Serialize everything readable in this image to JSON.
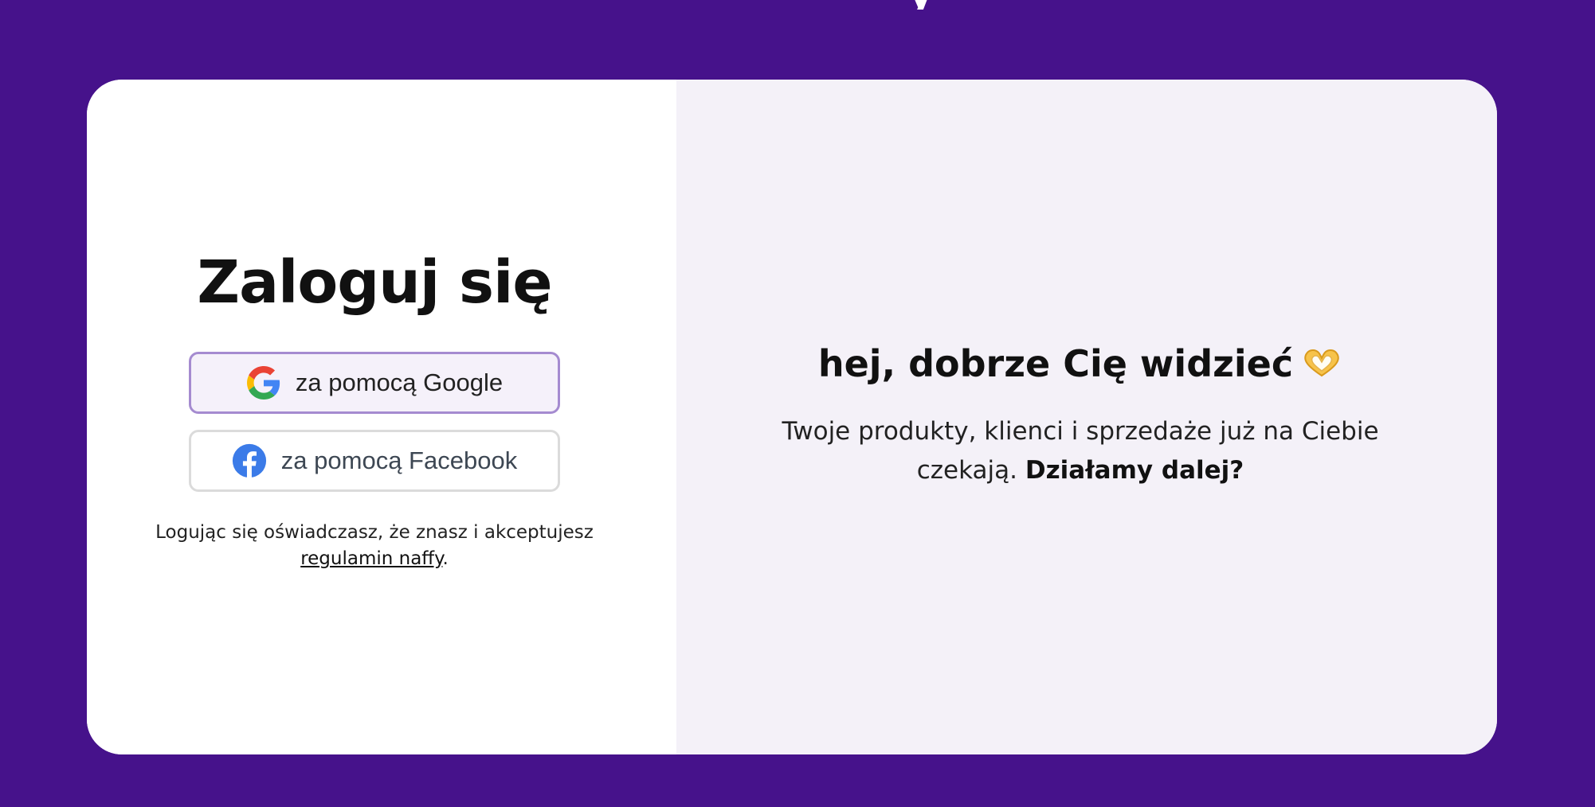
{
  "brand": {
    "logo_fragment": "y",
    "background_color": "#46128b",
    "accent_color": "#a58bd0"
  },
  "login": {
    "title": "Zaloguj się",
    "google_button": {
      "label": "za pomocą Google",
      "icon": "google-icon"
    },
    "facebook_button": {
      "label": "za pomocą Facebook",
      "icon": "facebook-icon"
    },
    "terms_prefix": "Logując się oświadczasz, że znasz i akceptujesz ",
    "terms_link": "regulamin naffy",
    "terms_suffix": "."
  },
  "welcome": {
    "title": "hej, dobrze Cię widzieć",
    "emoji_icon": "heart-hands-icon",
    "text": "Twoje produkty, klienci i sprzedaże już na Ciebie czekają. ",
    "cta": "Działamy dalej?"
  }
}
